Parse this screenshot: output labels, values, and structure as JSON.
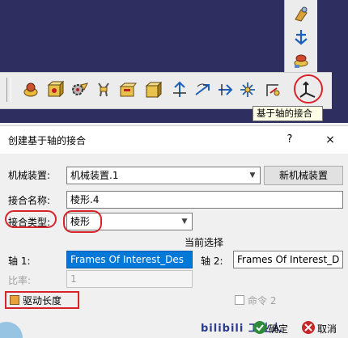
{
  "colors": {
    "viewport_bg": "#2f2e61",
    "highlight": "#0078d7",
    "annotation_red": "#d8232a"
  },
  "toolbar": {
    "vertical_icons": [
      "part-design-icon",
      "axis-icon",
      "assembly-stack-icon"
    ],
    "horizontal_icons": [
      "product-icon",
      "cube-constraint-icon",
      "gear-icon",
      "plug-icon",
      "block-icon",
      "box-icon",
      "joint-icon",
      "rotate-joint-icon",
      "cylinder-joint-icon",
      "spherical-joint-icon",
      "planar-joint-icon",
      "axis-based-joint-icon"
    ],
    "tooltip": "基于轴的接合"
  },
  "dialog": {
    "title": "创建基于轴的接合",
    "help": "?",
    "close": "×",
    "mechanism_label": "机械装置:",
    "mechanism_value": "机械装置.1",
    "new_mechanism_button": "新机械装置",
    "joint_name_label": "接合名称:",
    "joint_name_value": "棱形.4",
    "joint_type_label": "接合类型:",
    "joint_type_value": "棱形",
    "current_selection": "当前选择",
    "axis1_label": "轴 1:",
    "axis1_value": "Frames Of Interest_Des",
    "axis2_label": "轴 2:",
    "axis2_value": "Frames Of Interest_D",
    "ratio_label": "比率:",
    "ratio_value": "1",
    "drive_length_label": "驱动长度",
    "command2_label": "命令 2",
    "ok_label": "确定",
    "cancel_label": "取消",
    "watermark": "bilibili 工业人"
  }
}
